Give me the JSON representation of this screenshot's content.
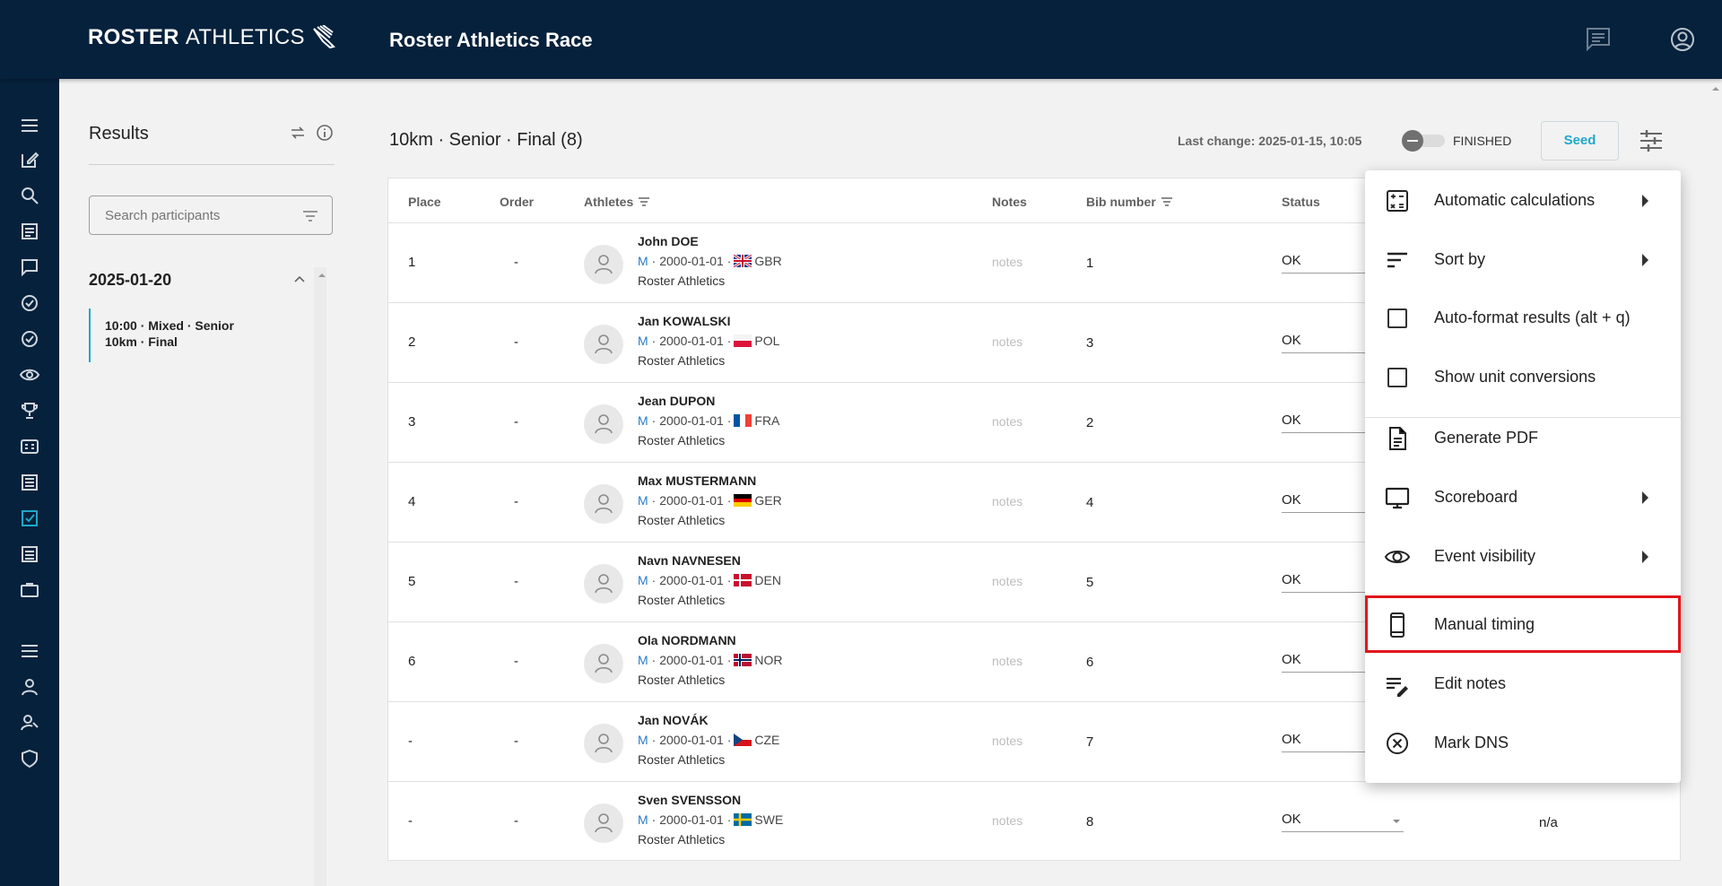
{
  "header": {
    "logo_bold": "ROSTER",
    "logo_light": "ATHLETICS",
    "app_title": "Roster Athletics Race"
  },
  "sidebar": {
    "title": "Results",
    "search_placeholder": "Search participants",
    "date": "2025-01-20",
    "event_line1": "10:00 · Mixed · Senior",
    "event_line2": "10km · Final"
  },
  "main": {
    "title": "10km · Senior · Final (8)",
    "last_change": "Last change: 2025-01-15, 10:05",
    "toggle_label": "FINISHED",
    "seed_label": "Seed"
  },
  "table": {
    "columns": {
      "place": "Place",
      "order": "Order",
      "athletes": "Athletes",
      "notes": "Notes",
      "bib": "Bib number",
      "status": "Status"
    },
    "rows": [
      {
        "place": "1",
        "order": "-",
        "name": "John DOE",
        "sex": "M",
        "dob": "· 2000-01-01 ·",
        "country": "GBR",
        "club": "Roster Athletics",
        "notes": "notes",
        "bib": "1",
        "status": "OK"
      },
      {
        "place": "2",
        "order": "-",
        "name": "Jan KOWALSKI",
        "sex": "M",
        "dob": "· 2000-01-01 ·",
        "country": "POL",
        "club": "Roster Athletics",
        "notes": "notes",
        "bib": "3",
        "status": "OK"
      },
      {
        "place": "3",
        "order": "-",
        "name": "Jean DUPON",
        "sex": "M",
        "dob": "· 2000-01-01 ·",
        "country": "FRA",
        "club": "Roster Athletics",
        "notes": "notes",
        "bib": "2",
        "status": "OK"
      },
      {
        "place": "4",
        "order": "-",
        "name": "Max MUSTERMANN",
        "sex": "M",
        "dob": "· 2000-01-01 ·",
        "country": "GER",
        "club": "Roster Athletics",
        "notes": "notes",
        "bib": "4",
        "status": "OK"
      },
      {
        "place": "5",
        "order": "-",
        "name": "Navn NAVNESEN",
        "sex": "M",
        "dob": "· 2000-01-01 ·",
        "country": "DEN",
        "club": "Roster Athletics",
        "notes": "notes",
        "bib": "5",
        "status": "OK"
      },
      {
        "place": "6",
        "order": "-",
        "name": "Ola NORDMANN",
        "sex": "M",
        "dob": "· 2000-01-01 ·",
        "country": "NOR",
        "club": "Roster Athletics",
        "notes": "notes",
        "bib": "6",
        "status": "OK"
      },
      {
        "place": "-",
        "order": "-",
        "name": "Jan NOVÁK",
        "sex": "M",
        "dob": "· 2000-01-01 ·",
        "country": "CZE",
        "club": "Roster Athletics",
        "notes": "notes",
        "bib": "7",
        "status": "OK"
      },
      {
        "place": "-",
        "order": "-",
        "name": "Sven SVENSSON",
        "sex": "M",
        "dob": "· 2000-01-01 ·",
        "country": "SWE",
        "club": "Roster Athletics",
        "notes": "notes",
        "bib": "8",
        "status": "OK",
        "extra": "n/a"
      }
    ]
  },
  "menu": {
    "items": [
      {
        "label": "Automatic calculations",
        "icon": "calculator-icon",
        "submenu": true
      },
      {
        "label": "Sort by",
        "icon": "sort-icon",
        "submenu": true
      },
      {
        "label": "Auto-format results (alt + q)",
        "icon": "checkbox-icon",
        "submenu": false
      },
      {
        "label": "Show unit conversions",
        "icon": "checkbox-icon",
        "submenu": false
      },
      {
        "label": "Generate PDF",
        "icon": "document-icon",
        "submenu": false
      },
      {
        "label": "Scoreboard",
        "icon": "monitor-icon",
        "submenu": true
      },
      {
        "label": "Event visibility",
        "icon": "eye-icon",
        "submenu": true
      },
      {
        "label": "Manual timing",
        "icon": "phone-icon",
        "submenu": false,
        "highlighted": true
      },
      {
        "label": "Edit notes",
        "icon": "edit-notes-icon",
        "submenu": false
      },
      {
        "label": "Mark DNS",
        "icon": "cancel-circle-icon",
        "submenu": false
      }
    ]
  },
  "colors": {
    "navy": "#06213c",
    "accent": "#1fa9c9",
    "highlight": "#e0161b"
  }
}
